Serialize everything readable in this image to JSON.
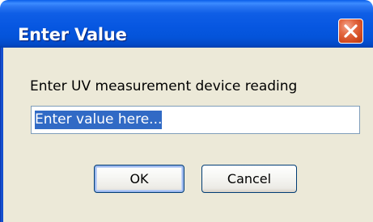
{
  "dialog": {
    "title": "Enter Value",
    "prompt": "Enter UV measurement device reading",
    "input": {
      "value": "Enter value here..."
    },
    "buttons": {
      "ok": "OK",
      "cancel": "Cancel"
    },
    "close_icon": "close-x-icon"
  },
  "colors": {
    "titlebar": "#0454da",
    "client_background": "#ece9d8",
    "close_button": "#d14a20",
    "selection": "#316ac5",
    "button_border": "#003c74"
  }
}
